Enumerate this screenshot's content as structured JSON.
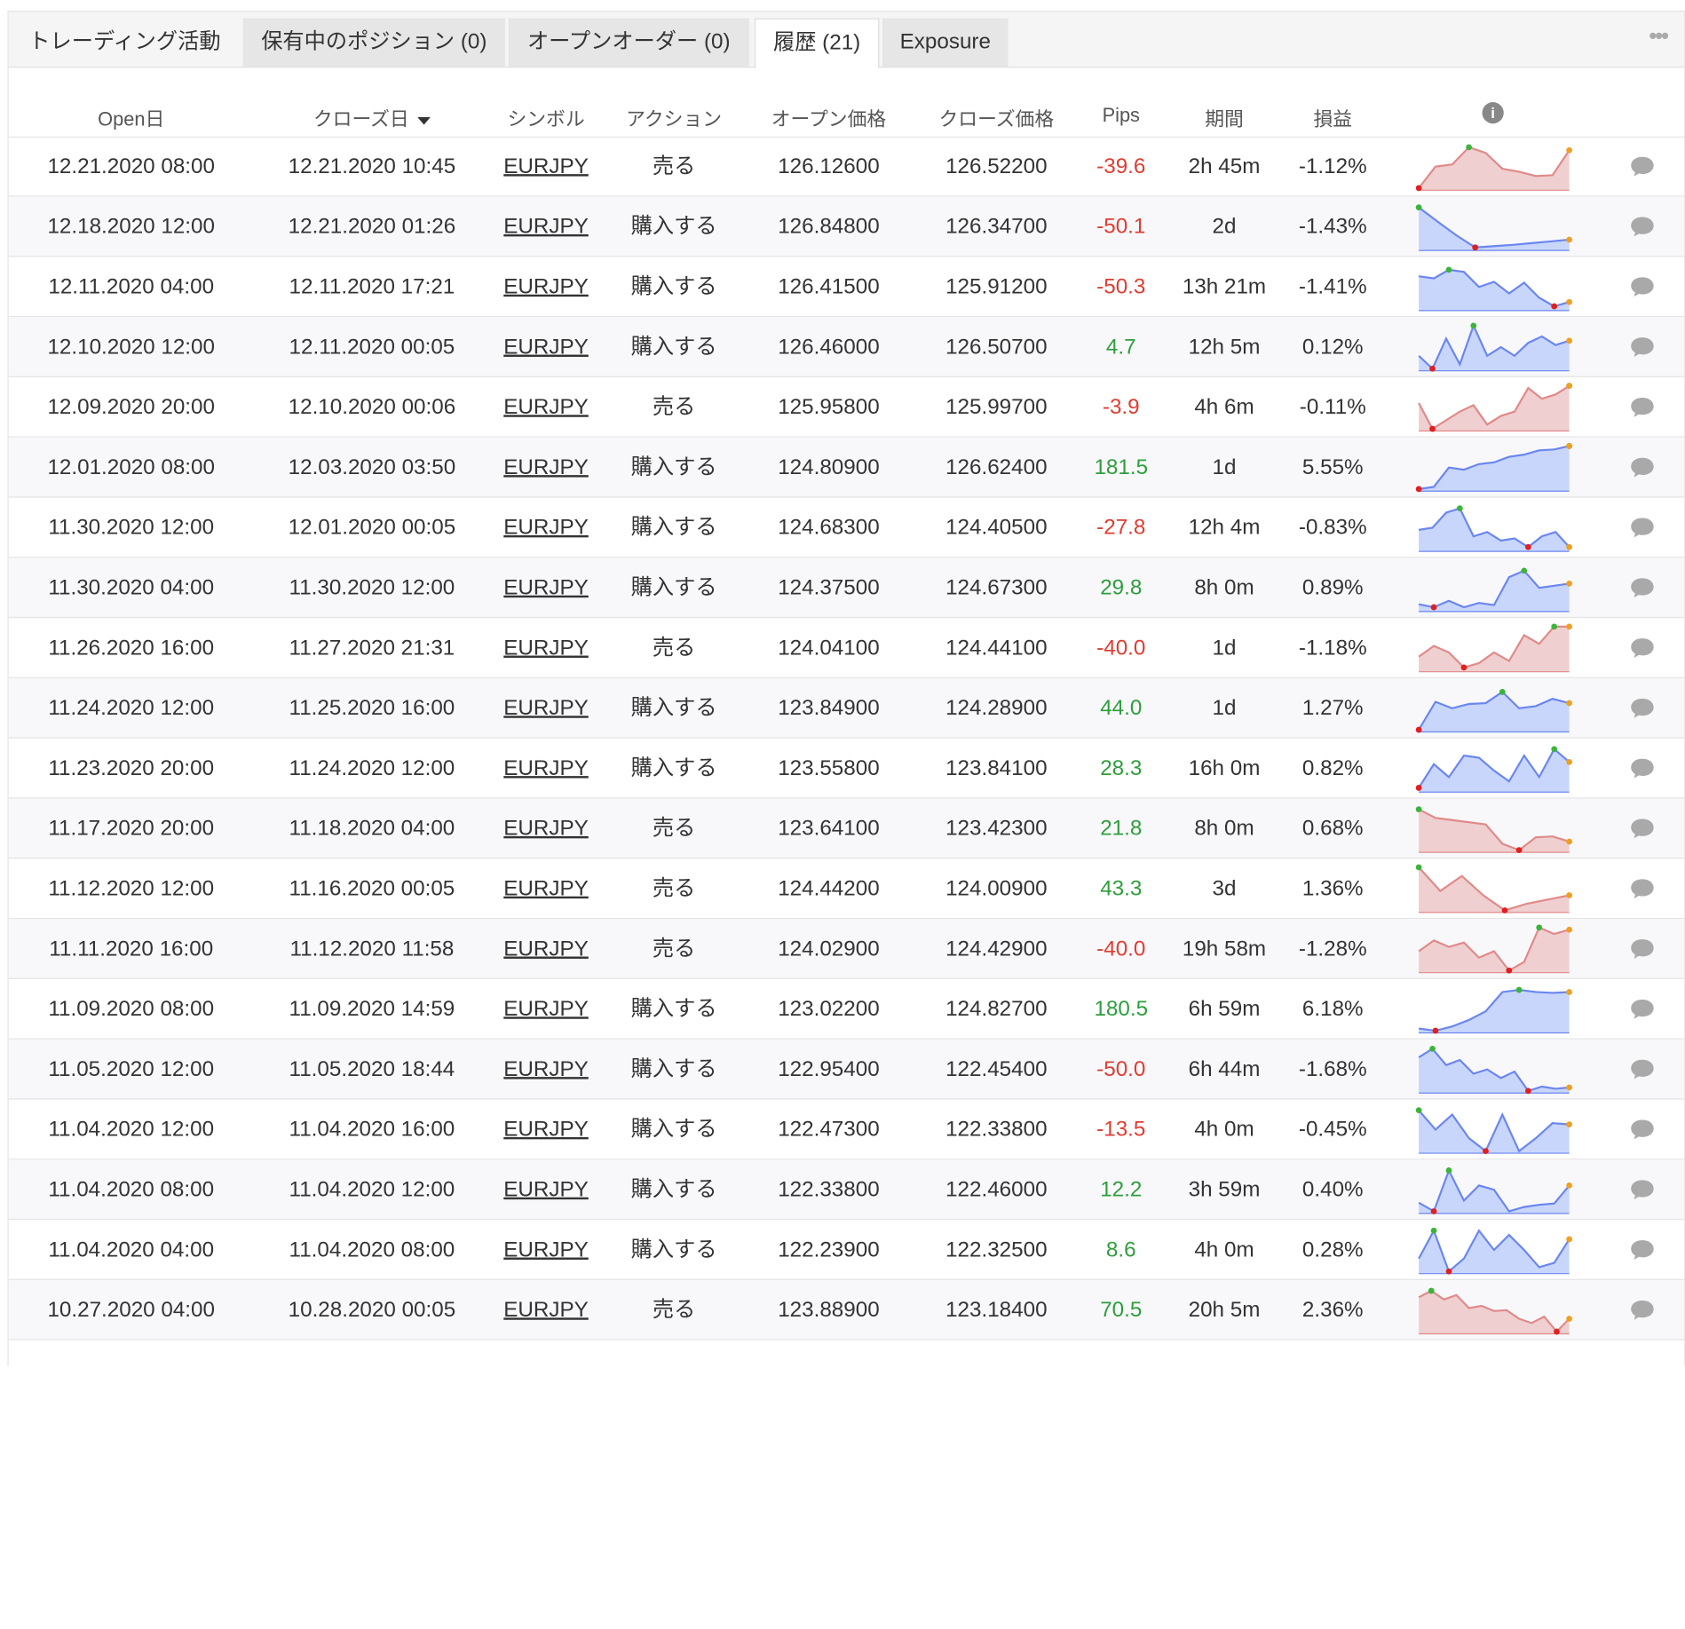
{
  "tabs": [
    {
      "label": "トレーディング活動"
    },
    {
      "label": "保有中のポジション (0)"
    },
    {
      "label": "オープンオーダー (0)"
    },
    {
      "label": "履歴 (21)"
    },
    {
      "label": "Exposure"
    }
  ],
  "more_label": "•••",
  "columns": {
    "open_date": "Open日",
    "close_date": "クローズ日",
    "symbol": "シンボル",
    "action": "アクション",
    "open_price": "オープン価格",
    "close_price": "クローズ価格",
    "pips": "Pips",
    "duration": "期間",
    "pnl": "損益",
    "info": "i"
  },
  "colors": {
    "negative_text": "#e03c31",
    "positive_text": "#2e9e3c",
    "spark_buy_line": "#6b86f0",
    "spark_buy_fill": "#c8d6fb",
    "spark_sell_line": "#e08a8a",
    "spark_sell_fill": "#efcfcf",
    "marker_high": "#3cb43c",
    "marker_low": "#e02020",
    "marker_end": "#f0a020"
  },
  "rows": [
    {
      "open": "12.21.2020 08:00",
      "close": "12.21.2020 10:45",
      "symbol": "EURJPY",
      "action": "売る",
      "open_price": "126.12600",
      "close_price": "126.52200",
      "pips": "-39.6",
      "duration": "2h 45m",
      "pnl": "-1.12%"
    },
    {
      "open": "12.18.2020 12:00",
      "close": "12.21.2020 01:26",
      "symbol": "EURJPY",
      "action": "購入する",
      "open_price": "126.84800",
      "close_price": "126.34700",
      "pips": "-50.1",
      "duration": "2d",
      "pnl": "-1.43%"
    },
    {
      "open": "12.11.2020 04:00",
      "close": "12.11.2020 17:21",
      "symbol": "EURJPY",
      "action": "購入する",
      "open_price": "126.41500",
      "close_price": "125.91200",
      "pips": "-50.3",
      "duration": "13h 21m",
      "pnl": "-1.41%"
    },
    {
      "open": "12.10.2020 12:00",
      "close": "12.11.2020 00:05",
      "symbol": "EURJPY",
      "action": "購入する",
      "open_price": "126.46000",
      "close_price": "126.50700",
      "pips": "4.7",
      "duration": "12h 5m",
      "pnl": "0.12%"
    },
    {
      "open": "12.09.2020 20:00",
      "close": "12.10.2020 00:06",
      "symbol": "EURJPY",
      "action": "売る",
      "open_price": "125.95800",
      "close_price": "125.99700",
      "pips": "-3.9",
      "duration": "4h 6m",
      "pnl": "-0.11%"
    },
    {
      "open": "12.01.2020 08:00",
      "close": "12.03.2020 03:50",
      "symbol": "EURJPY",
      "action": "購入する",
      "open_price": "124.80900",
      "close_price": "126.62400",
      "pips": "181.5",
      "duration": "1d",
      "pnl": "5.55%"
    },
    {
      "open": "11.30.2020 12:00",
      "close": "12.01.2020 00:05",
      "symbol": "EURJPY",
      "action": "購入する",
      "open_price": "124.68300",
      "close_price": "124.40500",
      "pips": "-27.8",
      "duration": "12h 4m",
      "pnl": "-0.83%"
    },
    {
      "open": "11.30.2020 04:00",
      "close": "11.30.2020 12:00",
      "symbol": "EURJPY",
      "action": "購入する",
      "open_price": "124.37500",
      "close_price": "124.67300",
      "pips": "29.8",
      "duration": "8h 0m",
      "pnl": "0.89%"
    },
    {
      "open": "11.26.2020 16:00",
      "close": "11.27.2020 21:31",
      "symbol": "EURJPY",
      "action": "売る",
      "open_price": "124.04100",
      "close_price": "124.44100",
      "pips": "-40.0",
      "duration": "1d",
      "pnl": "-1.18%"
    },
    {
      "open": "11.24.2020 12:00",
      "close": "11.25.2020 16:00",
      "symbol": "EURJPY",
      "action": "購入する",
      "open_price": "123.84900",
      "close_price": "124.28900",
      "pips": "44.0",
      "duration": "1d",
      "pnl": "1.27%"
    },
    {
      "open": "11.23.2020 20:00",
      "close": "11.24.2020 12:00",
      "symbol": "EURJPY",
      "action": "購入する",
      "open_price": "123.55800",
      "close_price": "123.84100",
      "pips": "28.3",
      "duration": "16h 0m",
      "pnl": "0.82%"
    },
    {
      "open": "11.17.2020 20:00",
      "close": "11.18.2020 04:00",
      "symbol": "EURJPY",
      "action": "売る",
      "open_price": "123.64100",
      "close_price": "123.42300",
      "pips": "21.8",
      "duration": "8h 0m",
      "pnl": "0.68%"
    },
    {
      "open": "11.12.2020 12:00",
      "close": "11.16.2020 00:05",
      "symbol": "EURJPY",
      "action": "売る",
      "open_price": "124.44200",
      "close_price": "124.00900",
      "pips": "43.3",
      "duration": "3d",
      "pnl": "1.36%"
    },
    {
      "open": "11.11.2020 16:00",
      "close": "11.12.2020 11:58",
      "symbol": "EURJPY",
      "action": "売る",
      "open_price": "124.02900",
      "close_price": "124.42900",
      "pips": "-40.0",
      "duration": "19h 58m",
      "pnl": "-1.28%"
    },
    {
      "open": "11.09.2020 08:00",
      "close": "11.09.2020 14:59",
      "symbol": "EURJPY",
      "action": "購入する",
      "open_price": "123.02200",
      "close_price": "124.82700",
      "pips": "180.5",
      "duration": "6h 59m",
      "pnl": "6.18%"
    },
    {
      "open": "11.05.2020 12:00",
      "close": "11.05.2020 18:44",
      "symbol": "EURJPY",
      "action": "購入する",
      "open_price": "122.95400",
      "close_price": "122.45400",
      "pips": "-50.0",
      "duration": "6h 44m",
      "pnl": "-1.68%"
    },
    {
      "open": "11.04.2020 12:00",
      "close": "11.04.2020 16:00",
      "symbol": "EURJPY",
      "action": "購入する",
      "open_price": "122.47300",
      "close_price": "122.33800",
      "pips": "-13.5",
      "duration": "4h 0m",
      "pnl": "-0.45%"
    },
    {
      "open": "11.04.2020 08:00",
      "close": "11.04.2020 12:00",
      "symbol": "EURJPY",
      "action": "購入する",
      "open_price": "122.33800",
      "close_price": "122.46000",
      "pips": "12.2",
      "duration": "3h 59m",
      "pnl": "0.40%"
    },
    {
      "open": "11.04.2020 04:00",
      "close": "11.04.2020 08:00",
      "symbol": "EURJPY",
      "action": "購入する",
      "open_price": "122.23900",
      "close_price": "122.32500",
      "pips": "8.6",
      "duration": "4h 0m",
      "pnl": "0.28%"
    },
    {
      "open": "10.27.2020 04:00",
      "close": "10.28.2020 00:05",
      "symbol": "EURJPY",
      "action": "売る",
      "open_price": "123.88900",
      "close_price": "123.18400",
      "pips": "70.5",
      "duration": "20h 5m",
      "pnl": "2.36%"
    }
  ]
}
